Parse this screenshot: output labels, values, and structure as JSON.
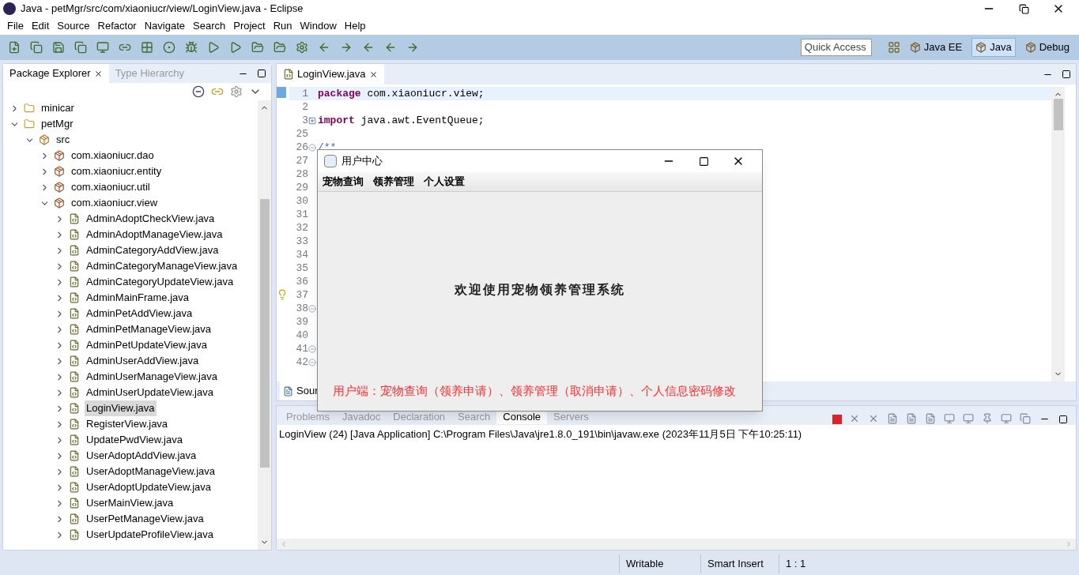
{
  "window": {
    "title": "Java - petMgr/src/com/xiaoniucr/view/LoginView.java - Eclipse"
  },
  "menu": [
    "File",
    "Edit",
    "Source",
    "Refactor",
    "Navigate",
    "Search",
    "Project",
    "Run",
    "Window",
    "Help"
  ],
  "quick_access": {
    "placeholder": "Quick Access"
  },
  "perspectives": [
    {
      "label": "Java EE",
      "selected": false
    },
    {
      "label": "Java",
      "selected": true
    },
    {
      "label": "Debug",
      "selected": false
    }
  ],
  "left_tabs": [
    {
      "label": "Package Explorer",
      "selected": true
    },
    {
      "label": "Type Hierarchy",
      "selected": false
    }
  ],
  "tree": [
    {
      "label": "minicar",
      "kind": "project",
      "expanded": false,
      "selected": false
    },
    {
      "label": "petMgr",
      "kind": "project",
      "expanded": true,
      "selected": false,
      "children": [
        {
          "label": "src",
          "kind": "source",
          "expanded": true,
          "selected": false,
          "children": [
            {
              "label": "com.xiaoniucr.dao",
              "kind": "package",
              "expanded": false,
              "selected": false
            },
            {
              "label": "com.xiaoniucr.entity",
              "kind": "package",
              "expanded": false,
              "selected": false
            },
            {
              "label": "com.xiaoniucr.util",
              "kind": "package",
              "expanded": false,
              "selected": false
            },
            {
              "label": "com.xiaoniucr.view",
              "kind": "package",
              "expanded": true,
              "selected": false,
              "children": [
                {
                  "label": "AdminAdoptCheckView.java",
                  "kind": "file",
                  "expanded": false,
                  "selected": false
                },
                {
                  "label": "AdminAdoptManageView.java",
                  "kind": "file",
                  "expanded": false,
                  "selected": false
                },
                {
                  "label": "AdminCategoryAddView.java",
                  "kind": "file",
                  "expanded": false,
                  "selected": false
                },
                {
                  "label": "AdminCategoryManageView.java",
                  "kind": "file",
                  "expanded": false,
                  "selected": false
                },
                {
                  "label": "AdminCategoryUpdateView.java",
                  "kind": "file",
                  "expanded": false,
                  "selected": false
                },
                {
                  "label": "AdminMainFrame.java",
                  "kind": "file",
                  "expanded": false,
                  "selected": false
                },
                {
                  "label": "AdminPetAddView.java",
                  "kind": "file",
                  "expanded": false,
                  "selected": false
                },
                {
                  "label": "AdminPetManageView.java",
                  "kind": "file",
                  "expanded": false,
                  "selected": false
                },
                {
                  "label": "AdminPetUpdateView.java",
                  "kind": "file",
                  "expanded": false,
                  "selected": false
                },
                {
                  "label": "AdminUserAddView.java",
                  "kind": "file",
                  "expanded": false,
                  "selected": false
                },
                {
                  "label": "AdminUserManageView.java",
                  "kind": "file",
                  "expanded": false,
                  "selected": false
                },
                {
                  "label": "AdminUserUpdateView.java",
                  "kind": "file",
                  "expanded": false,
                  "selected": false
                },
                {
                  "label": "LoginView.java",
                  "kind": "file",
                  "expanded": false,
                  "selected": true
                },
                {
                  "label": "RegisterView.java",
                  "kind": "file",
                  "expanded": false,
                  "selected": false
                },
                {
                  "label": "UpdatePwdView.java",
                  "kind": "file",
                  "expanded": false,
                  "selected": false
                },
                {
                  "label": "UserAdoptAddView.java",
                  "kind": "file",
                  "expanded": false,
                  "selected": false
                },
                {
                  "label": "UserAdoptManageView.java",
                  "kind": "file",
                  "expanded": false,
                  "selected": false
                },
                {
                  "label": "UserAdoptUpdateView.java",
                  "kind": "file",
                  "expanded": false,
                  "selected": false
                },
                {
                  "label": "UserMainView.java",
                  "kind": "file",
                  "expanded": false,
                  "selected": false
                },
                {
                  "label": "UserPetManageView.java",
                  "kind": "file",
                  "expanded": false,
                  "selected": false
                },
                {
                  "label": "UserUpdateProfileView.java",
                  "kind": "file",
                  "expanded": false,
                  "selected": false
                }
              ]
            }
          ]
        }
      ]
    }
  ],
  "editor": {
    "tab": "LoginView.java",
    "bottom_tab": "Sour",
    "lines": [
      {
        "number": "1",
        "keyword": "package",
        "code": " com.xiaoniucr.view;"
      },
      {
        "number": "2"
      },
      {
        "number": "3",
        "keyword": "import",
        "code": " java.awt.EventQueue;",
        "collapsed": true
      },
      {
        "number": "25"
      },
      {
        "number": "26",
        "comment": "/**",
        "collapsed": false
      },
      {
        "number": "27"
      },
      {
        "number": "28"
      },
      {
        "number": "29"
      },
      {
        "number": "30"
      },
      {
        "number": "31"
      },
      {
        "number": "32"
      },
      {
        "number": "33"
      },
      {
        "number": "34"
      },
      {
        "number": "35"
      },
      {
        "number": "36"
      },
      {
        "number": "37"
      },
      {
        "number": "38",
        "collapsed": false
      },
      {
        "number": "39"
      },
      {
        "number": "40"
      },
      {
        "number": "41",
        "collapsed": false
      },
      {
        "number": "42",
        "collapsed": false
      }
    ]
  },
  "console": {
    "tabs": [
      {
        "label": "Problems",
        "selected": false
      },
      {
        "label": "Javadoc",
        "selected": false
      },
      {
        "label": "Declaration",
        "selected": false
      },
      {
        "label": "Search",
        "selected": false
      },
      {
        "label": "Console",
        "selected": true
      },
      {
        "label": "Servers",
        "selected": false
      }
    ],
    "text": "LoginView (24) [Java Application] C:\\Program Files\\Java\\jre1.8.0_191\\bin\\javaw.exe (2023年11月5日 下午10:25:11)"
  },
  "dialog": {
    "title": "用户中心",
    "menu": [
      "宠物查询",
      "领养管理",
      "个人设置"
    ],
    "welcome": "欢迎使用宠物领养管理系统",
    "note": "用户端：宠物查询（领养申请）、领养管理（取消申请）、个人信息密码修改"
  },
  "status_bar": [
    "Writable",
    "Smart Insert",
    "1 : 1"
  ]
}
